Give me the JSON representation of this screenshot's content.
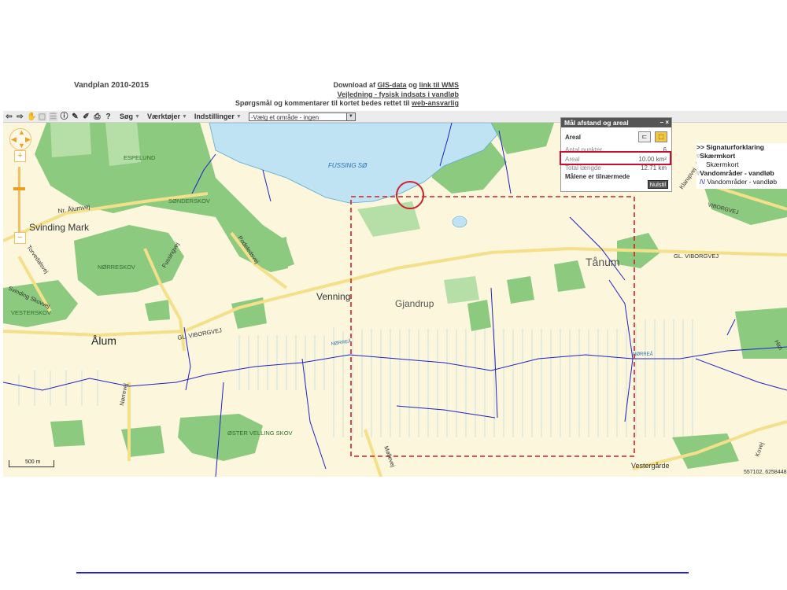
{
  "header": {
    "title": "Vandplan 2010-2015",
    "link1_prefix": "Download af ",
    "link1_a": "GIS-data",
    "link1_mid": " og ",
    "link1_b": "link til WMS",
    "link2": "Vejledning - fysisk indsats i vandløb",
    "link3_prefix": "Spørgsmål og kommentarer til kortet bedes rettet til ",
    "link3_link": "web-ansvarlig"
  },
  "toolbar": {
    "menu_search": "Søg",
    "menu_tools": "Værktøjer",
    "menu_settings": "Indstillinger",
    "area_select": "-Vælg et område - ingen"
  },
  "measure_panel": {
    "title": "Mål afstand og areal",
    "mode": "Areal",
    "points_label": "Antal punkter",
    "points_value": "6",
    "area_label": "Areal",
    "area_value": "10.00 km²",
    "length_label": "Total længde",
    "length_value": "12.71 km",
    "note": "Målene er tilnærmede",
    "reset_label": "Nulstil"
  },
  "legend": {
    "title": ">> Signaturforklaring",
    "group1": "Skærmkort",
    "item1": "Skærmkort",
    "group2": "Vandområder - vandløb",
    "item2": "Vandområder - vandløb"
  },
  "map": {
    "labels": {
      "lake": "FUSSING SØ",
      "espelund": "ESPELUND",
      "sonderskov": "SØNDERSKOV",
      "norreskov": "NØRRESKOV",
      "vesterskov": "VESTERSKOV",
      "oster_velling": "ØSTER VELLING SKOV",
      "svinding_mark": "Svinding Mark",
      "venning": "Venning",
      "gjandrup": "Gjandrup",
      "tanum": "Tånum",
      "alum": "Ålum",
      "vestergarde": "Vestergårde",
      "nr_alumvej": "Nr. Ålumvej",
      "fussingvej": "Fussingvej",
      "podeledsvej": "Podeledsvej",
      "torvedalsvej": "Torvedalsvej",
      "svinding_skovvej": "Svinding Skovvej",
      "gl_viborgvej_w": "GL. VIBORGVEJ",
      "gl_viborgvej_e": "GL. VIBORGVEJ",
      "viborgvej_ne": "VIBORGVEJ",
      "norre_aa": "NØRREÅ",
      "norre_aa_e": "NØRREÅ",
      "norrevej": "Nørrevej",
      "klarup": "Klarupvej",
      "mollevej": "Møllevej",
      "kovej": "Kovej",
      "himmel": "Him"
    },
    "scale_label": "500 m",
    "coordinates": "557102, 6258448"
  },
  "colors": {
    "lake": "#bfe3f2",
    "forest": "#8cca7f",
    "field": "#fbf6dc",
    "stream": "#2020c8",
    "measure_outline": "#d0202a",
    "road": "#f7e79a"
  }
}
